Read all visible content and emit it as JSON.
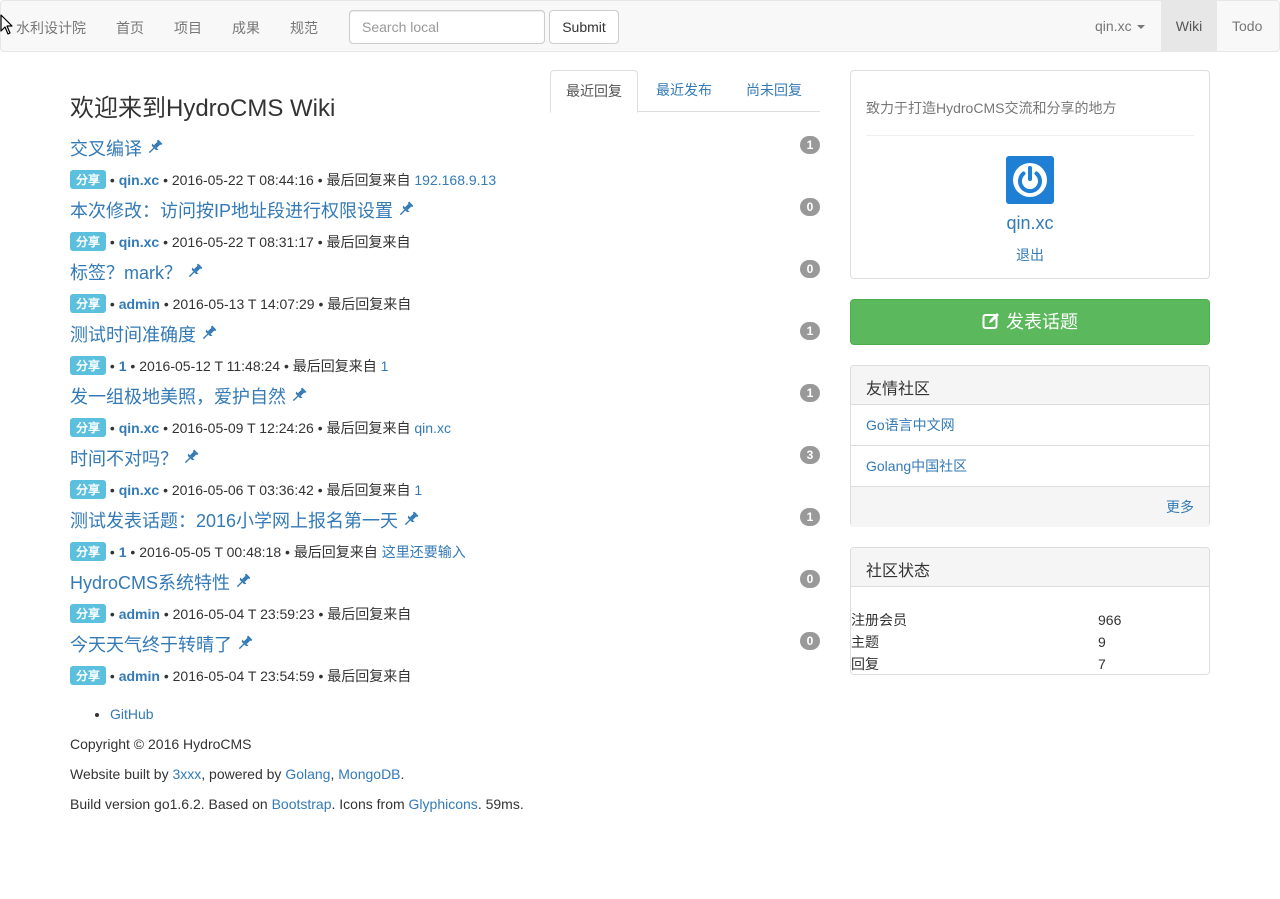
{
  "navbar": {
    "brand": "水利设计院",
    "links": [
      "首页",
      "项目",
      "成果",
      "规范"
    ],
    "search_placeholder": "Search local",
    "submit_label": "Submit",
    "user": "qin.xc",
    "wiki": "Wiki",
    "todo": "Todo"
  },
  "page": {
    "title": "欢迎来到HydroCMS Wiki"
  },
  "tabs": [
    "最近回复",
    "最近发布",
    "尚未回复"
  ],
  "topics": [
    {
      "title": "交叉编译",
      "count": "1",
      "label": "分享",
      "author": "qin.xc",
      "time": "2016-05-22 T 08:44:16",
      "reply_text": "最后回复来自",
      "last_reply": "192.168.9.13"
    },
    {
      "title": "本次修改：访问按IP地址段进行权限设置",
      "count": "0",
      "label": "分享",
      "author": "qin.xc",
      "time": "2016-05-22 T 08:31:17",
      "reply_text": "最后回复来自",
      "last_reply": ""
    },
    {
      "title": "标签？mark？",
      "count": "0",
      "label": "分享",
      "author": "admin",
      "time": "2016-05-13 T 14:07:29",
      "reply_text": "最后回复来自",
      "last_reply": ""
    },
    {
      "title": "测试时间准确度",
      "count": "1",
      "label": "分享",
      "author": "1",
      "time": "2016-05-12 T 11:48:24",
      "reply_text": "最后回复来自",
      "last_reply": "1"
    },
    {
      "title": "发一组极地美照，爱护自然",
      "count": "1",
      "label": "分享",
      "author": "qin.xc",
      "time": "2016-05-09 T 12:24:26",
      "reply_text": "最后回复来自",
      "last_reply": "qin.xc"
    },
    {
      "title": "时间不对吗？",
      "count": "3",
      "label": "分享",
      "author": "qin.xc",
      "time": "2016-05-06 T 03:36:42",
      "reply_text": "最后回复来自",
      "last_reply": "1"
    },
    {
      "title": "测试发表话题：2016小学网上报名第一天",
      "count": "1",
      "label": "分享",
      "author": "1",
      "time": "2016-05-05 T 00:48:18",
      "reply_text": "最后回复来自",
      "last_reply": "这里还要输入"
    },
    {
      "title": "HydroCMS系统特性",
      "count": "0",
      "label": "分享",
      "author": "admin",
      "time": "2016-05-04 T 23:59:23",
      "reply_text": "最后回复来自",
      "last_reply": ""
    },
    {
      "title": "今天天气终于转晴了",
      "count": "0",
      "label": "分享",
      "author": "admin",
      "time": "2016-05-04 T 23:54:59",
      "reply_text": "最后回复来自",
      "last_reply": ""
    }
  ],
  "footer": {
    "github": "GitHub",
    "copyright": "Copyright © 2016 HydroCMS",
    "built_prefix": "Website built by ",
    "built_by": "3xxx",
    "powered_prefix": ", powered by ",
    "golang": "Golang",
    "sep": ", ",
    "mongodb": "MongoDB",
    "dot": ".",
    "build_prefix": "Build version go1.6.2. Based on ",
    "bootstrap": "Bootstrap",
    "icons_prefix": ". Icons from ",
    "glyphicons": "Glyphicons",
    "time_suffix": ". 59ms."
  },
  "sidebar": {
    "intro": "致力于打造HydroCMS交流和分享的地方",
    "profile_name": "qin.xc",
    "logout": "退出",
    "new_topic": "发表话题",
    "friends_title": "友情社区",
    "friends": [
      "Go语言中文网",
      "Golang中国社区"
    ],
    "more": "更多",
    "stats_title": "社区状态",
    "stats": [
      {
        "label": "注册会员",
        "value": "966"
      },
      {
        "label": "主题",
        "value": "9"
      },
      {
        "label": "回复",
        "value": "7"
      }
    ]
  },
  "colors": {
    "link": "#337ab7",
    "success": "#5cb85c",
    "info_label": "#5bc0de",
    "badge": "#999999",
    "avatar": "#1e7fd5"
  },
  "icons": [
    "pushpin-icon",
    "edit-icon",
    "power-icon",
    "caret-down-icon",
    "mouse-cursor-icon"
  ]
}
